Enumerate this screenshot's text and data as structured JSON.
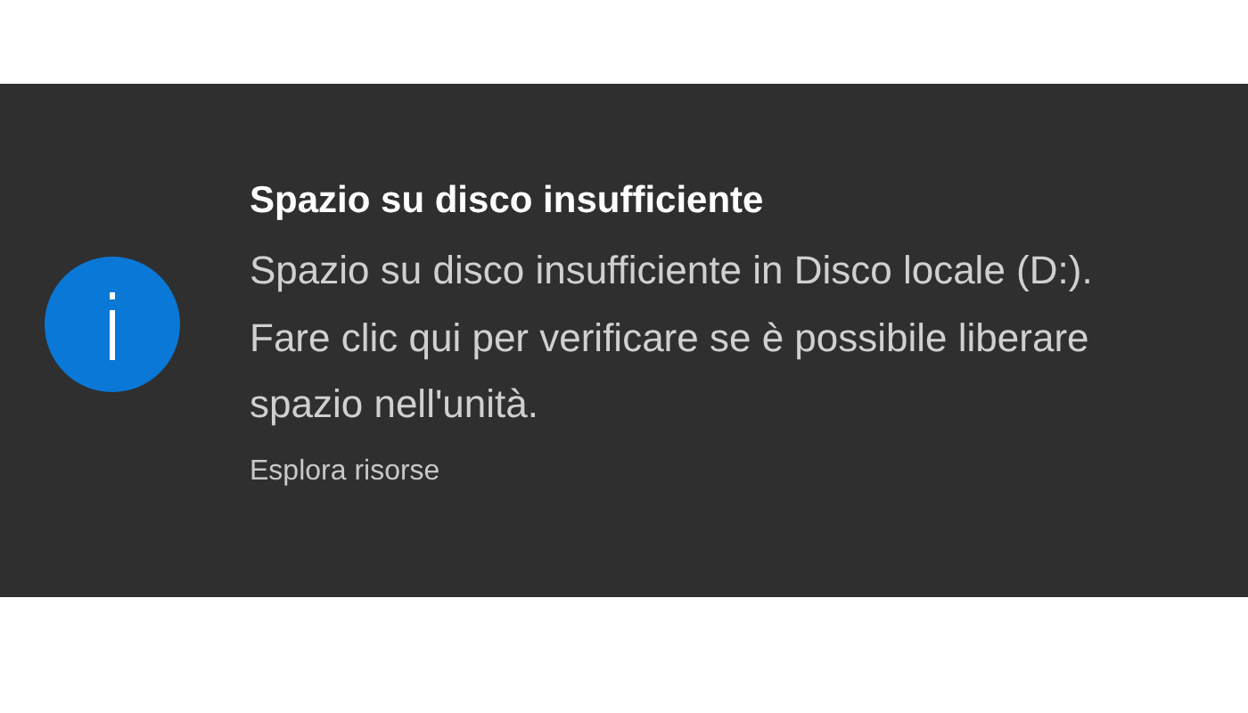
{
  "notification": {
    "title": "Spazio su disco insufficiente",
    "messages": [
      "Spazio su disco insufficiente in Disco locale (D:).",
      "Fare clic qui per verificare se è possibile liberare spazio nell'unità."
    ],
    "source": "Esplora risorse"
  }
}
